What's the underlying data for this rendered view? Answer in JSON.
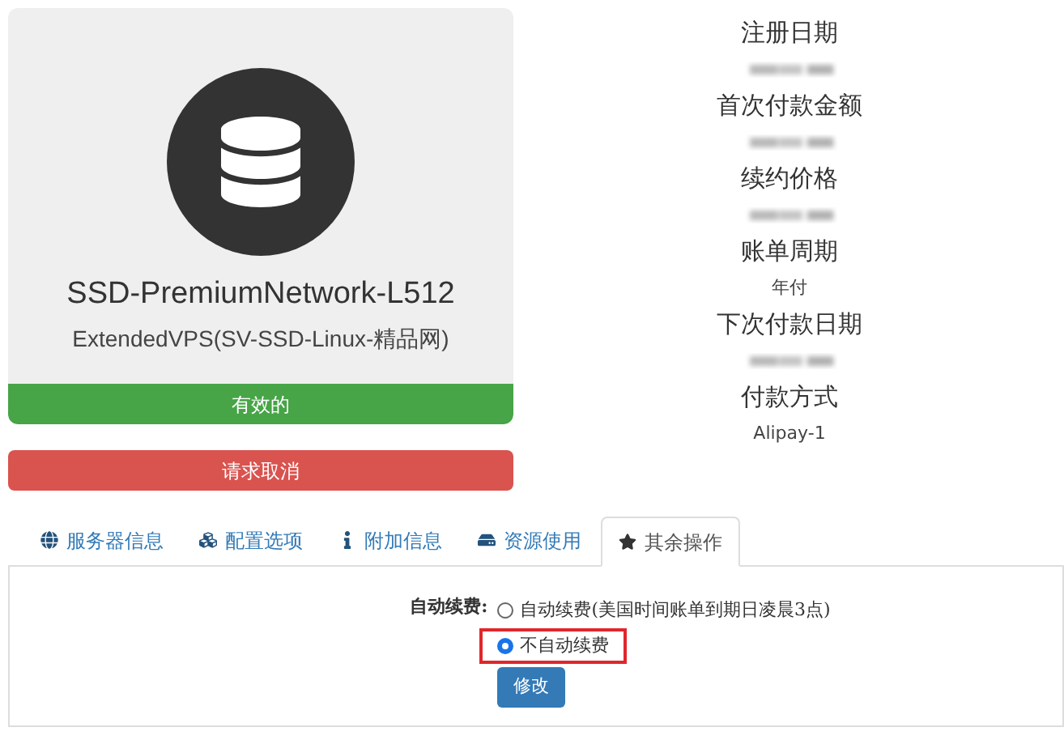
{
  "product": {
    "name": "SSD-PremiumNetwork-L512",
    "group": "ExtendedVPS(SV-SSD-Linux-精品网)",
    "status": "有效的"
  },
  "cancel_button": "请求取消",
  "details": [
    {
      "label": "注册日期",
      "kind": "blurred"
    },
    {
      "label": "首次付款金额",
      "kind": "blurred"
    },
    {
      "label": "续约价格",
      "kind": "blurred"
    },
    {
      "label": "账单周期",
      "kind": "text",
      "value": "年付"
    },
    {
      "label": "下次付款日期",
      "kind": "blurred"
    },
    {
      "label": "付款方式",
      "kind": "text",
      "value": "Alipay-1"
    }
  ],
  "tabs": [
    {
      "label": "服务器信息",
      "kind": "globe",
      "selected": false
    },
    {
      "label": "配置选项",
      "kind": "cubes",
      "selected": false
    },
    {
      "label": "附加信息",
      "kind": "info",
      "selected": false
    },
    {
      "label": "资源使用",
      "kind": "drive",
      "selected": false
    },
    {
      "label": "其余操作",
      "kind": "star",
      "selected": true
    }
  ],
  "auto_renew": {
    "label": "自动续费:",
    "options": [
      {
        "label": "自动续费(美国时间账单到期日凌晨3点)",
        "selected": false,
        "highlighted": false
      },
      {
        "label": "不自动续费",
        "selected": true,
        "highlighted": true
      }
    ],
    "submit": "修改"
  }
}
